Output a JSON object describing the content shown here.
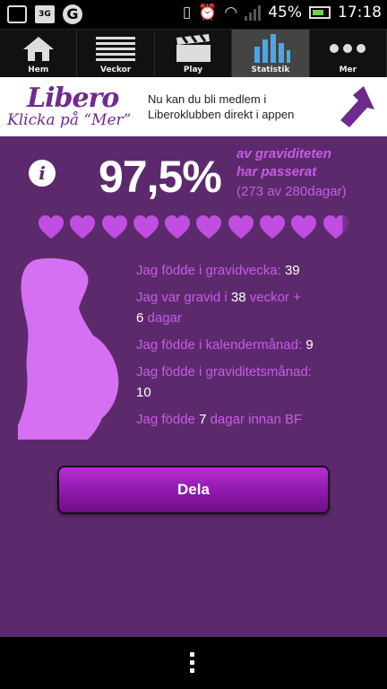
{
  "status_bar": {
    "net_badge": "3G",
    "app_badge": "G",
    "battery": "45%",
    "time": "17:18"
  },
  "tabs": [
    {
      "label": "Hem",
      "icon": "home-icon",
      "active": false
    },
    {
      "label": "Veckor",
      "icon": "list-icon",
      "active": false
    },
    {
      "label": "Play",
      "icon": "clapperboard-icon",
      "active": false
    },
    {
      "label": "Statistik",
      "icon": "bar-chart-icon",
      "active": true
    },
    {
      "label": "Mer",
      "icon": "more-dots-icon",
      "active": false
    }
  ],
  "banner": {
    "logo": "Libero",
    "tagline": "Klicka på “Mer”",
    "text": "Nu kan du bli medlem i Liberoklubben direkt i appen"
  },
  "progress": {
    "percent": "97,5%",
    "passed_line1": "av graviditeten",
    "passed_line2": "har passerat",
    "days_text": "(273 av 280dagar)",
    "hearts_total": 10,
    "hearts_full": 9.75
  },
  "facts": [
    {
      "before": "Jag födde i gravidvecka:",
      "value": "39",
      "after": ""
    },
    {
      "before": "Jag var gravid i",
      "value": "38",
      "after": "veckor +",
      "value2": "6",
      "after2": "dagar"
    },
    {
      "before": "Jag födde i kalendermånad:",
      "value": "9",
      "after": ""
    },
    {
      "before": "Jag födde i graviditetsmånad:",
      "value": "10",
      "after": ""
    },
    {
      "before": "Jag födde",
      "value": "7",
      "after": "dagar innan BF"
    }
  ],
  "share_button": "Dela",
  "colors": {
    "background": "#5c2a6c",
    "accent": "#c75be6",
    "brand": "#6f2a8e",
    "button": "#8d18a9"
  }
}
